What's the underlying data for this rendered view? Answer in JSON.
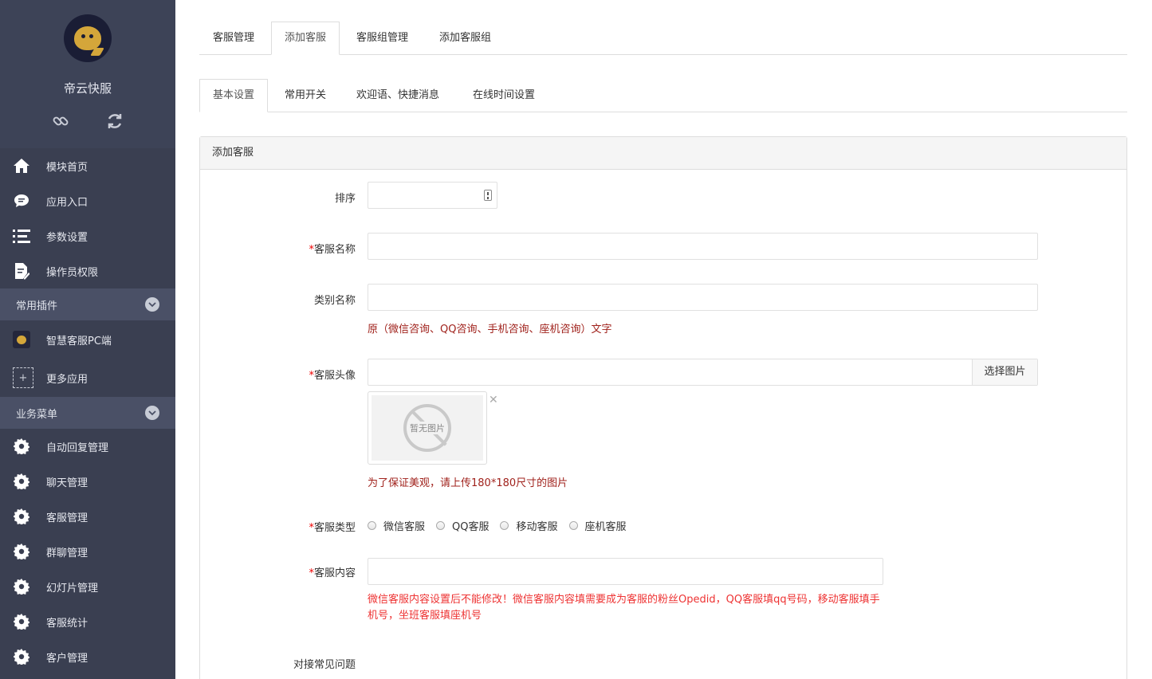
{
  "sidebar": {
    "app_name": "帝云快服",
    "nav": [
      {
        "label": "模块首页",
        "icon": "home-icon"
      },
      {
        "label": "应用入口",
        "icon": "chat-bubble-icon"
      },
      {
        "label": "参数设置",
        "icon": "list-settings-icon"
      },
      {
        "label": "操作员权限",
        "icon": "document-edit-icon"
      }
    ],
    "plugins_group": "常用插件",
    "plugins": [
      {
        "label": "智慧客服PC端"
      },
      {
        "label": "更多应用"
      }
    ],
    "business_group": "业务菜单",
    "business": [
      {
        "label": "自动回复管理"
      },
      {
        "label": "聊天管理"
      },
      {
        "label": "客服管理"
      },
      {
        "label": "群聊管理"
      },
      {
        "label": "幻灯片管理"
      },
      {
        "label": "客服统计"
      },
      {
        "label": "客户管理"
      }
    ]
  },
  "top_tabs": [
    "客服管理",
    "添加客服",
    "客服组管理",
    "添加客服组"
  ],
  "top_tabs_active": "添加客服",
  "sub_tabs": [
    "基本设置",
    "常用开关",
    "欢迎语、快捷消息",
    "在线时间设置"
  ],
  "sub_tabs_active": "基本设置",
  "panel_title": "添加客服",
  "form": {
    "sort_label": "排序",
    "sort_value": "",
    "name_label": "客服名称",
    "name_value": "",
    "category_label": "类别名称",
    "category_value": "",
    "category_help": "原（微信咨询、QQ咨询、手机咨询、座机咨询）文字",
    "avatar_label": "客服头像",
    "avatar_value": "",
    "pick_image": "选择图片",
    "no_image": "暂无图片",
    "avatar_help": "为了保证美观，请上传180*180尺寸的图片",
    "type_label": "客服类型",
    "types": [
      "微信客服",
      "QQ客服",
      "移动客服",
      "座机客服"
    ],
    "content_label": "客服内容",
    "content_value": "",
    "content_help": "微信客服内容设置后不能修改！微信客服内容填需要成为客服的粉丝Opedid，QQ客服填qq号码，移动客服填手机号，坐班客服填座机号",
    "faq_label": "对接常见问题",
    "required_mark": "*"
  },
  "colors": {
    "sidebar_bg": "#3a3f51",
    "group_bg": "#4a5066",
    "help_text": "#a0221c",
    "warn_text": "#e33333",
    "required": "#ee0000"
  }
}
